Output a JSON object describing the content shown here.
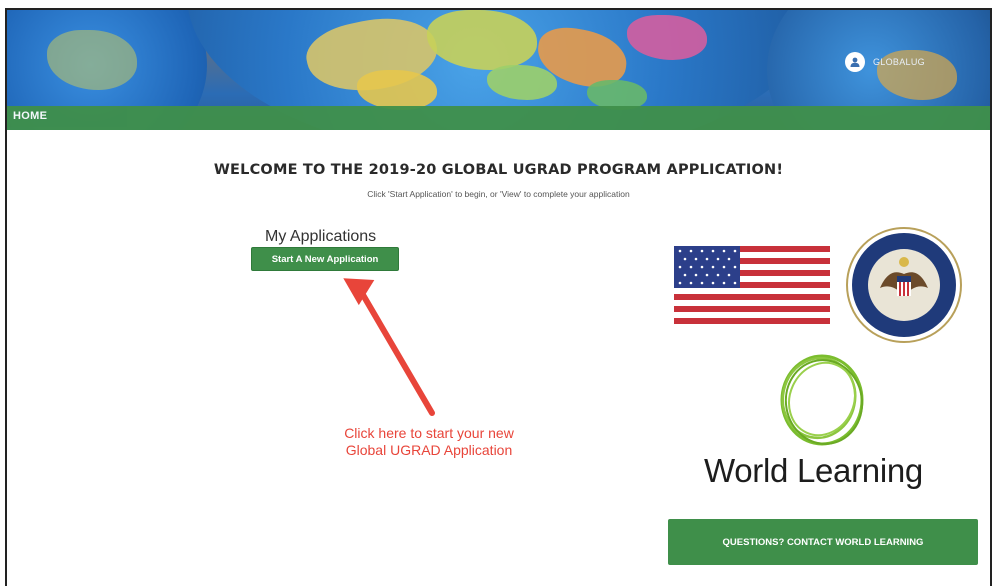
{
  "header": {
    "nav_home": "HOME",
    "user_name": "GLOBALUG"
  },
  "main": {
    "title": "WELCOME TO THE 2019-20 GLOBAL UGRAD PROGRAM APPLICATION!",
    "subtitle": "Click 'Start Application' to begin, or 'View' to complete your application",
    "my_applications": {
      "heading": "My Applications",
      "start_button": "Start A New Application"
    },
    "annotation": {
      "text": "Click here to start your new Global UGRAD Application",
      "color": "#e8453a"
    }
  },
  "sidebar": {
    "world_learning": "World Learning",
    "contact_button": "QUESTIONS? CONTACT WORLD LEARNING"
  },
  "colors": {
    "brand_green": "#3f8f4a",
    "annotation_red": "#e8453a"
  },
  "icons": [
    "user-icon",
    "us-flag",
    "department-of-state-seal",
    "world-learning-logo",
    "arrow-annotation"
  ]
}
